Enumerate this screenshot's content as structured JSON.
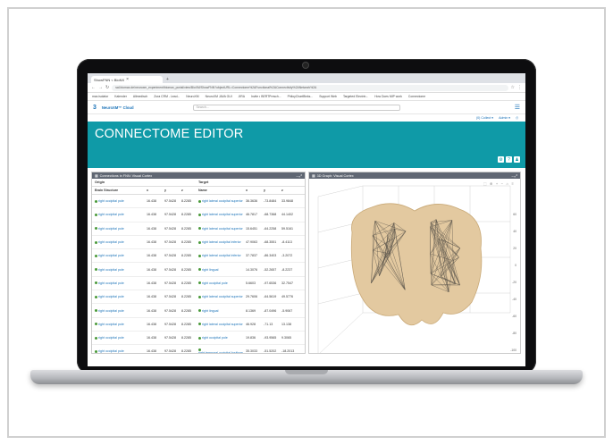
{
  "browser": {
    "tab_title": "ShowFNN < BioNX",
    "url": "sal.biomax.de/neuroxm_experiment/biomax_portal/view/BioXM/ShowFNN?objectURL=Connectome%2AFunctional%2AConnectivity%2ANetwork%2A",
    "bookmarks": [
      "max.isolator",
      "Kalender",
      "Allmedisch",
      "Zora CRM - Lead...",
      "NeuroXM",
      "NeuroXM JAVA GUI",
      "JIRA",
      "Invite • BERTPresch...",
      "PhiloyChartBinks...",
      "Support Web",
      "Targeted Electrin...",
      "How Does MIP work",
      "Connectome"
    ]
  },
  "app": {
    "logo": "3",
    "brand": "NeuroXM™ Cloud",
    "search_placeholder": "Search...",
    "menu_collect": "(0) Collect ▾",
    "menu_admin": "Admin ▾"
  },
  "banner": {
    "title": "CONNECTOME EDITOR"
  },
  "left_panel": {
    "title": "Connections in FNN: Visual Cortex",
    "origin_label": "Origin",
    "target_label": "Target",
    "columns": [
      "Brain Structure",
      "x",
      "y",
      "z",
      "Name",
      "x",
      "y",
      "z"
    ],
    "rows": [
      [
        "right occipital pole",
        "16.438",
        "97.5428",
        "8.2285",
        "right lateral occipital superior",
        "36.3636",
        "-73.8484",
        "33.9848"
      ],
      [
        "right occipital pole",
        "16.438",
        "97.5428",
        "8.2285",
        "right lateral occipital superior",
        "46.7817",
        "-68.7368",
        "44.1402"
      ],
      [
        "right occipital pole",
        "16.438",
        "97.5428",
        "8.2285",
        "right lateral occipital superior",
        "15.6451",
        "-64.2258",
        "59.5161"
      ],
      [
        "right occipital pole",
        "16.438",
        "97.5428",
        "8.2285",
        "right lateral occipital inferior",
        "47.9063",
        "-68.3551",
        "-8.4113"
      ],
      [
        "right occipital pole",
        "16.438",
        "97.5428",
        "8.2285",
        "right lateral occipital inferior",
        "37.7837",
        "-86.3403",
        "-3.2072"
      ],
      [
        "right occipital pole",
        "16.438",
        "97.5428",
        "8.2285",
        "right lingual",
        "14.3076",
        "-52.2657",
        "-8.2237"
      ],
      [
        "right occipital pole",
        "16.438",
        "97.5428",
        "8.2285",
        "right occipital pole",
        "5.6603",
        "-97.6536",
        "32.7547"
      ],
      [
        "right occipital pole",
        "16.438",
        "97.5428",
        "8.2285",
        "right lateral occipital superior",
        "29.7606",
        "-64.5619",
        "49.5776"
      ],
      [
        "right occipital pole",
        "16.438",
        "97.5428",
        "8.2285",
        "right lingual",
        "8.1369",
        "-87.0496",
        "-5.9067"
      ],
      [
        "right occipital pole",
        "16.438",
        "97.5428",
        "8.2285",
        "right lateral occipital superior",
        "46.928",
        "-71.13",
        "13.138"
      ],
      [
        "right occipital pole",
        "16.438",
        "97.5428",
        "8.2285",
        "right occipital pole",
        "19.836",
        "-93.9565",
        "9.3065"
      ],
      [
        "right occipital pole",
        "16.438",
        "97.5428",
        "8.2285",
        "right temporal occipital fusiform",
        "35.3033",
        "-51.5202",
        "-18.2013"
      ]
    ]
  },
  "right_panel": {
    "title": "3D Graph: Visual Cortex",
    "axis_ticks": [
      "60",
      "40",
      "20",
      "0",
      "-20",
      "-40",
      "-60",
      "-80",
      "-100"
    ]
  },
  "colors": {
    "banner": "#0f9aa7",
    "panel_header": "#606773",
    "link": "#1a72b8",
    "brain": "#e3c9a0"
  }
}
